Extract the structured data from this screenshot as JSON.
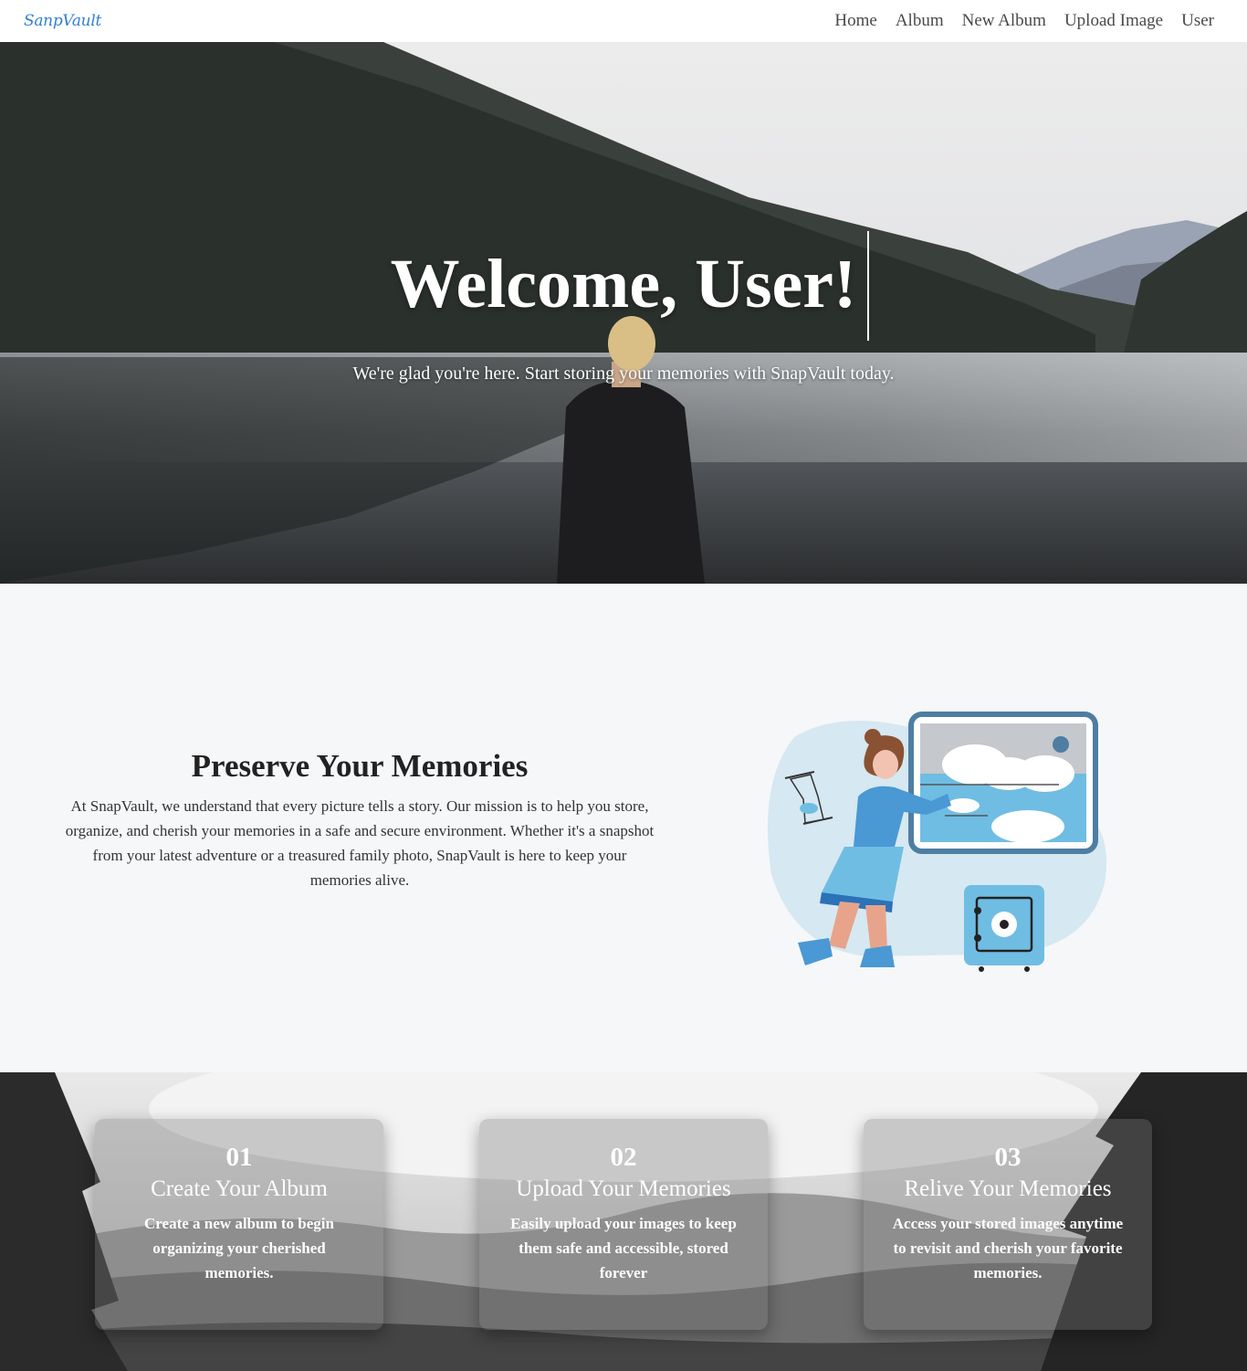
{
  "navbar": {
    "brand": "SanpVault",
    "links": [
      "Home",
      "Album",
      "New Album",
      "Upload Image",
      "User"
    ]
  },
  "hero": {
    "title": "Welcome, User!",
    "subtitle": "We're glad you're here. Start storing your memories with SnapVault today."
  },
  "about": {
    "title": "Preserve Your Memories",
    "text": "At SnapVault, we understand that every picture tells a story. Our mission is to help you store, organize, and cherish your memories in a safe and secure environment. Whether it's a snapshot from your latest adventure or a treasured family photo, SnapVault is here to keep your memories alive."
  },
  "steps": [
    {
      "number": "01",
      "title": "Create Your Album",
      "text": "Create a new album to begin organizing your cherished memories."
    },
    {
      "number": "02",
      "title": "Upload Your Memories",
      "text": "Easily upload your images to keep them safe and accessible, stored forever"
    },
    {
      "number": "03",
      "title": "Relive Your Memories",
      "text": "Access your stored images anytime to revisit and cherish your favorite memories."
    }
  ],
  "colors": {
    "brand": "#2f7fd6",
    "page_background": "#f6f7f9",
    "illustration_blue": "#6fbde3"
  },
  "icons": {
    "illustration": "woman-with-photo-frame-and-safe-illustration",
    "hero_background": "lake-forest-photo"
  }
}
